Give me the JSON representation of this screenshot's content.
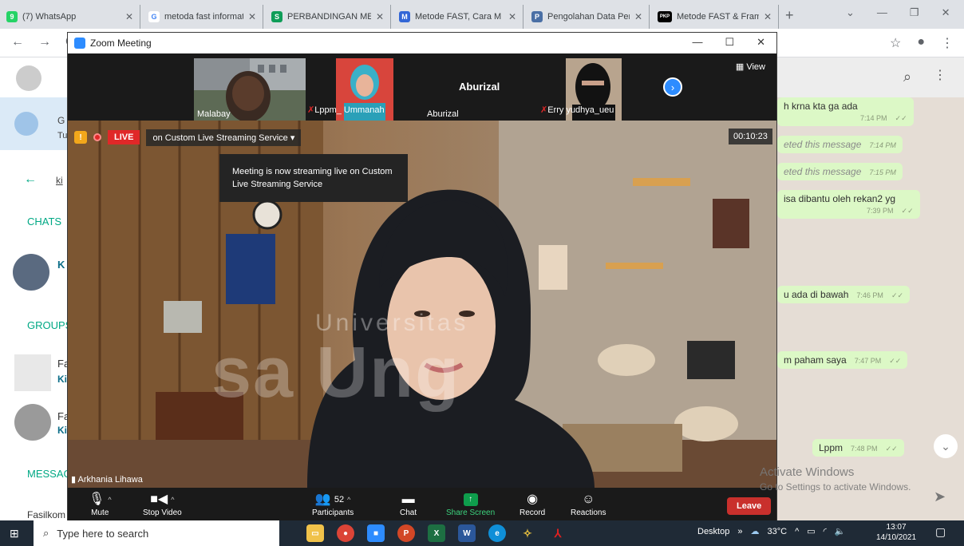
{
  "browser": {
    "tabs": [
      {
        "title": "(7) WhatsApp",
        "fav_color": "#25d366",
        "fav_glyph": "9"
      },
      {
        "title": "metoda fast informati",
        "fav_color": "#4285f4",
        "fav_glyph": "G"
      },
      {
        "title": "PERBANDINGAN MET",
        "fav_color": "#0f9d58",
        "fav_glyph": "S"
      },
      {
        "title": "Metode FAST, Cara M",
        "fav_color": "#3367d6",
        "fav_glyph": "M"
      },
      {
        "title": "Pengolahan Data Pen",
        "fav_color": "#4a6fa5",
        "fav_glyph": "P"
      },
      {
        "title": "Metode FAST & Frame",
        "fav_color": "#000000",
        "fav_glyph": "PKP"
      }
    ],
    "new_tab": "+"
  },
  "whatsapp": {
    "left_labels": {
      "chats": "CHATS",
      "groups": "GROUPS",
      "messages": "MESSAG",
      "back_label": "ki",
      "g_label": "G",
      "tu_label": "Tu",
      "k_label": "K",
      "fa1": "Fa",
      "ki1": "Ki",
      "fa2": "Fa",
      "ki2": "Ki",
      "fasilkom": "Fasilkom F"
    },
    "messages": [
      {
        "text": "h krna kta ga ada",
        "time": "7:14 PM",
        "deleted": false
      },
      {
        "text": "eted this message",
        "time": "7:14 PM",
        "deleted": true
      },
      {
        "text": "eted this message",
        "time": "7:15 PM",
        "deleted": true
      },
      {
        "text": "isa dibantu oleh rekan2 yg",
        "time": "7:39 PM",
        "deleted": false
      },
      {
        "text": "u ada di bawah",
        "time": "7:46 PM",
        "deleted": false
      },
      {
        "text": "m paham saya",
        "time": "7:47 PM",
        "deleted": false
      },
      {
        "text": "Lppm",
        "time": "7:48 PM",
        "deleted": false
      }
    ]
  },
  "zoom": {
    "window_title": "Zoom Meeting",
    "participants_strip": [
      {
        "name": "Malabay",
        "muted": false
      },
      {
        "name": "Lppm_ Ummanah",
        "muted": true
      },
      {
        "name": "Aburizal",
        "muted": false,
        "center_name": "Aburizal"
      },
      {
        "name": "Erry yudhya_ueu",
        "muted": true
      }
    ],
    "view_label": "View",
    "live": {
      "badge": "LIVE",
      "service": "on Custom Live Streaming Service",
      "timer": "00:10:23",
      "tooltip": "Meeting is now streaming live on Custom Live Streaming Service",
      "rec_label": "Recording"
    },
    "active_speaker": "Arkhania Lihawa",
    "watermark": "sa Ung",
    "watermark_small": "Universitas",
    "toolbar": {
      "mute": "Mute",
      "stop_video": "Stop Video",
      "participants": "Participants",
      "participants_count": "52",
      "chat": "Chat",
      "share_screen": "Share Screen",
      "record": "Record",
      "reactions": "Reactions",
      "leave": "Leave"
    }
  },
  "windows": {
    "activate_title": "Activate Windows",
    "activate_sub": "Go to Settings to activate Windows.",
    "search_placeholder": "Type here to search",
    "desktop": "Desktop",
    "temperature": "33°C",
    "time": "13:07",
    "date": "14/10/2021"
  },
  "colors": {
    "zoom_blue": "#2d8cff",
    "live_red": "#e02828",
    "share_green": "#0e9d4c",
    "wa_bubble": "#dcf8c6"
  }
}
